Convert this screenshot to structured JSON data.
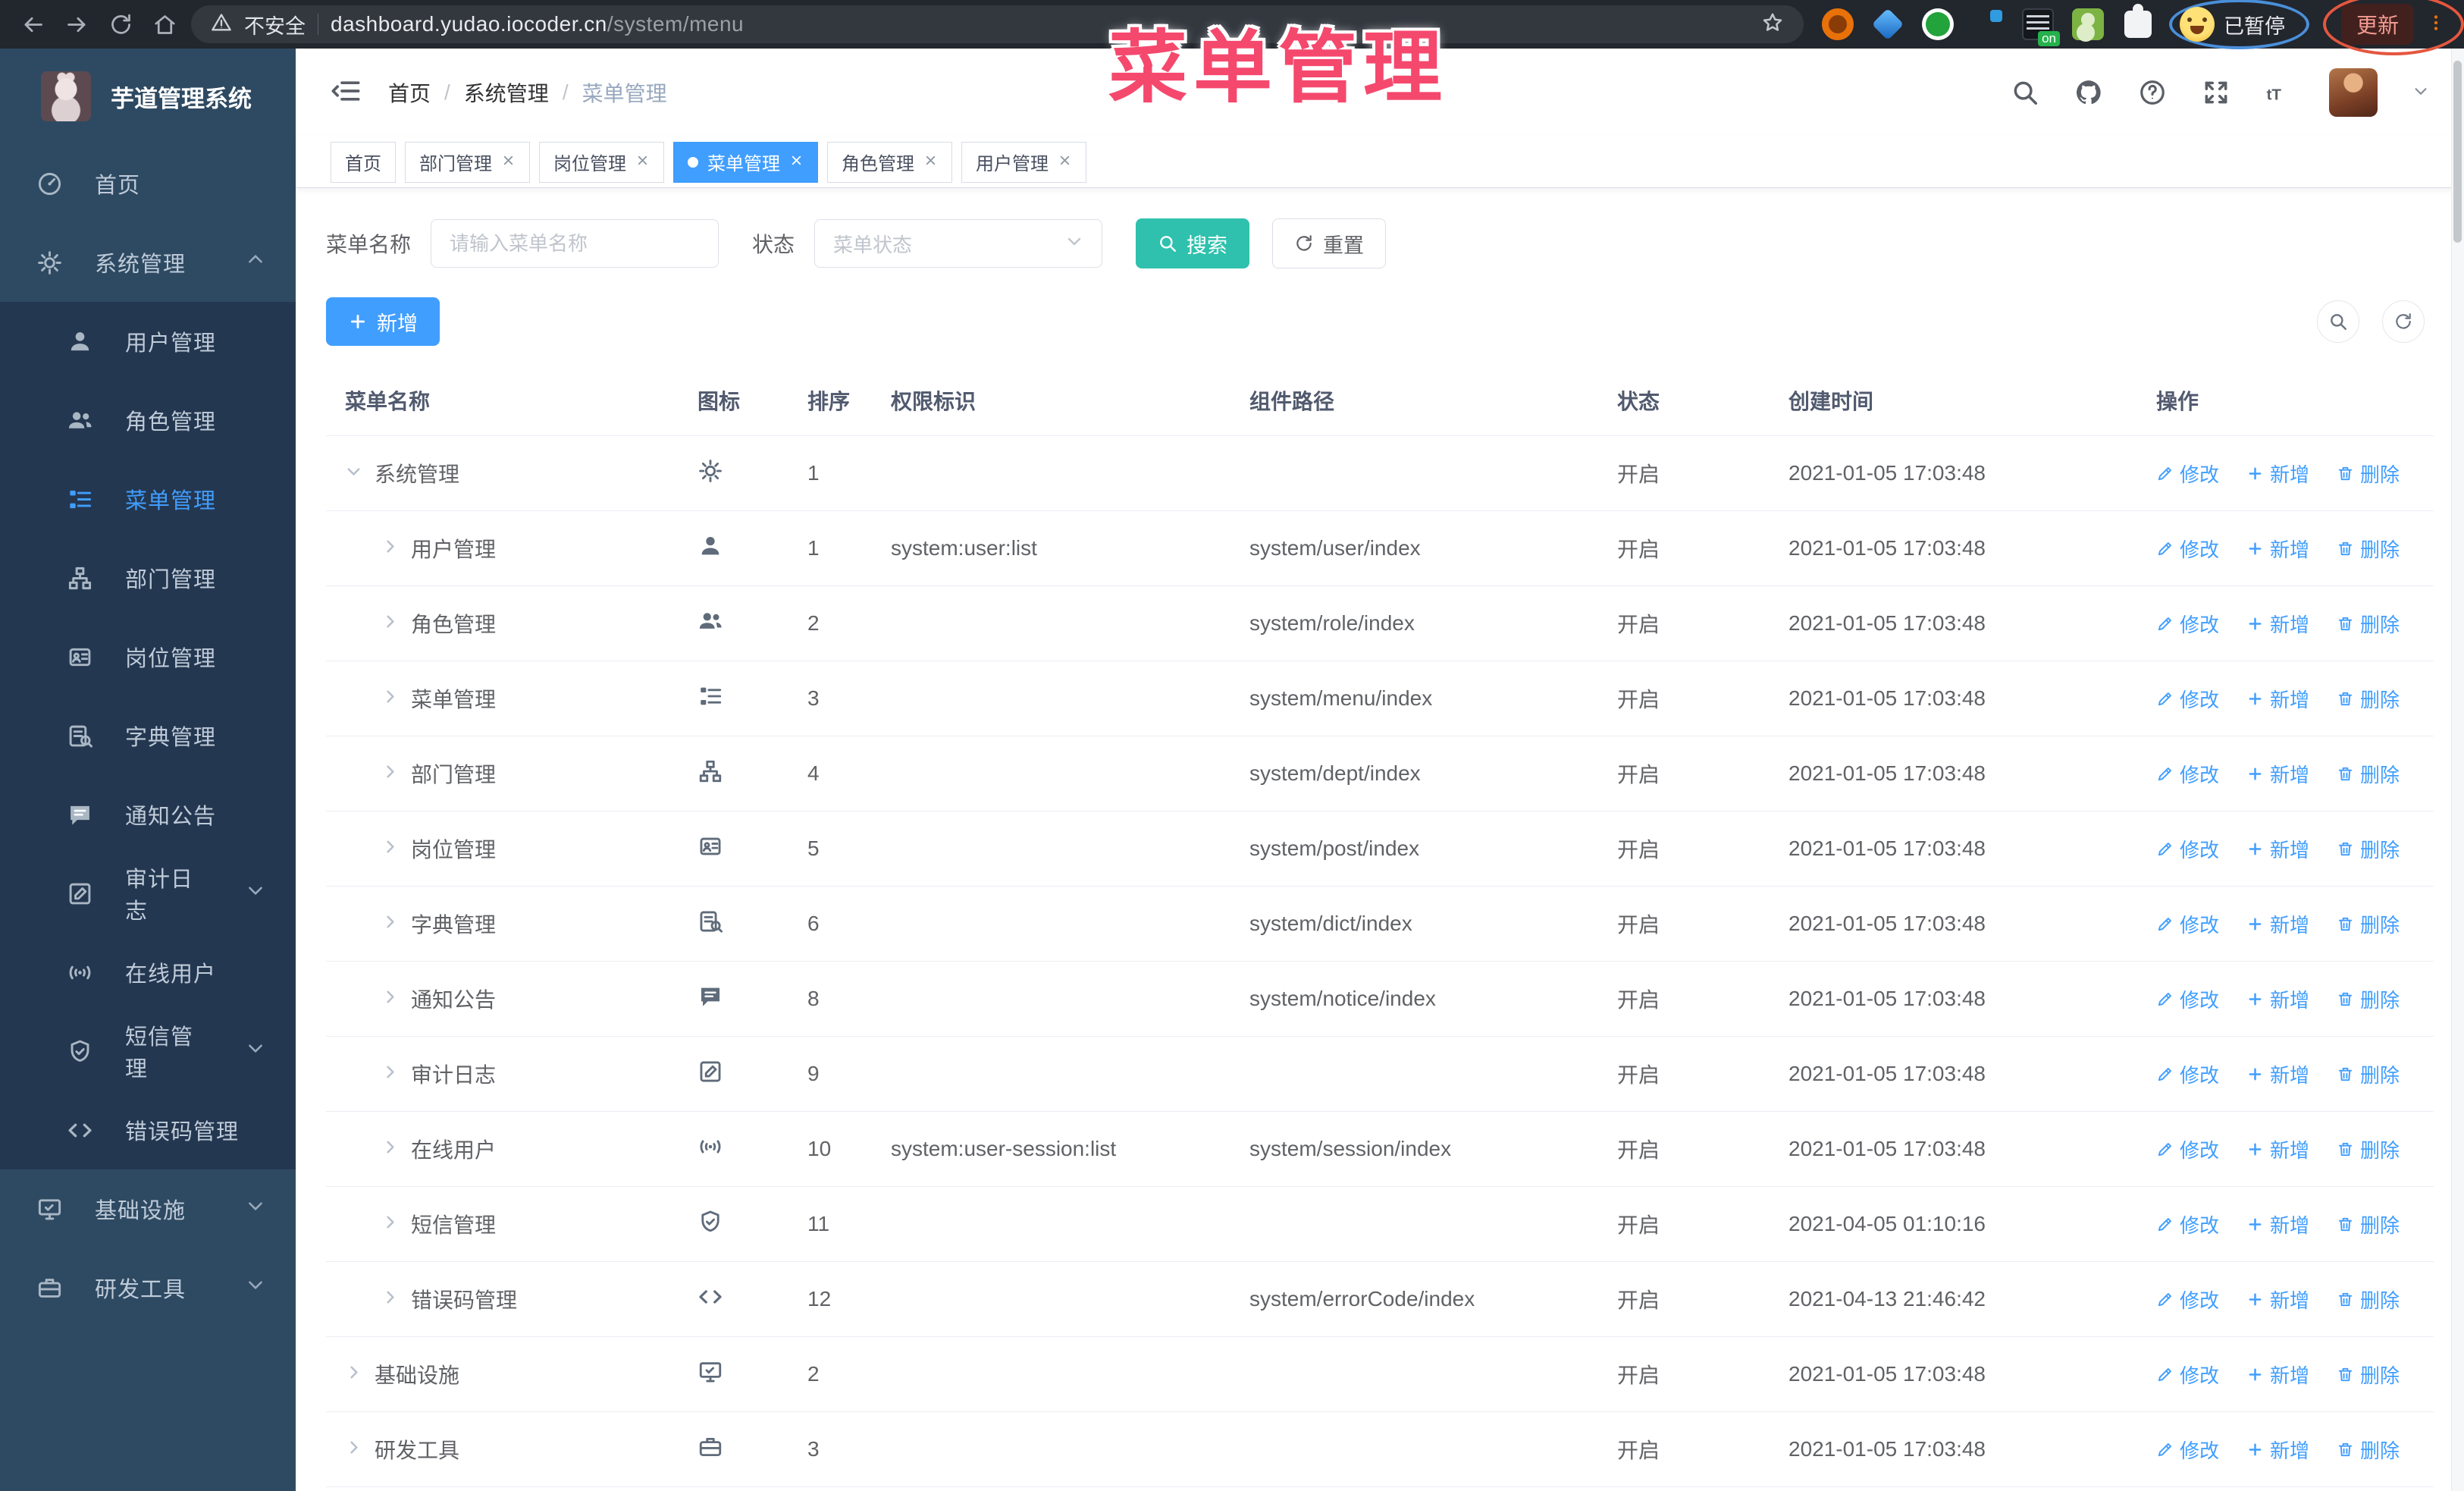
{
  "colors": {
    "accent": "#409EFF",
    "search_button": "#2FC1AD",
    "annotation": "#F5486D",
    "sidebar_bg": "#2E4A62",
    "submenu_bg": "#243750",
    "active_tab": "#409EFF"
  },
  "browser": {
    "nav_icons": [
      "back-icon",
      "forward-icon",
      "reload-icon",
      "home-icon"
    ],
    "security_label": "不安全",
    "url_host": "dashboard.yudao.iocoder.cn",
    "url_path": "/system/menu",
    "extension_icons": [
      "target-icon",
      "gem-icon",
      "shield-check-icon",
      "grid-icon",
      "switch-on-icon",
      "profile-icon",
      "puzzle-icon"
    ],
    "paused_label": "已暂停",
    "update_label": "更新"
  },
  "annotation": {
    "title": "菜单管理"
  },
  "sidebar": {
    "logo_title": "芋道管理系统",
    "menu": [
      {
        "label": "首页",
        "icon": "dashboard",
        "level": 0
      },
      {
        "label": "系统管理",
        "icon": "gear",
        "level": 0,
        "caret": "up"
      },
      {
        "label": "用户管理",
        "icon": "user",
        "level": 1
      },
      {
        "label": "角色管理",
        "icon": "users",
        "level": 1
      },
      {
        "label": "菜单管理",
        "icon": "tree-table",
        "level": 1,
        "active": true
      },
      {
        "label": "部门管理",
        "icon": "tree",
        "level": 1
      },
      {
        "label": "岗位管理",
        "icon": "post",
        "level": 1
      },
      {
        "label": "字典管理",
        "icon": "dict",
        "level": 1
      },
      {
        "label": "通知公告",
        "icon": "message",
        "level": 1
      },
      {
        "label": "审计日志",
        "icon": "log",
        "level": 1,
        "caret": "down"
      },
      {
        "label": "在线用户",
        "icon": "online",
        "level": 1
      },
      {
        "label": "短信管理",
        "icon": "sms",
        "level": 1,
        "caret": "down"
      },
      {
        "label": "错误码管理",
        "icon": "code",
        "level": 1
      },
      {
        "label": "基础设施",
        "icon": "monitor",
        "level": 0,
        "caret": "down"
      },
      {
        "label": "研发工具",
        "icon": "tool",
        "level": 0,
        "caret": "down"
      }
    ]
  },
  "header": {
    "breadcrumb": [
      "首页",
      "系统管理",
      "菜单管理"
    ],
    "icons": [
      "search",
      "github",
      "question",
      "fullscreen",
      "fontsize"
    ]
  },
  "tabs": [
    {
      "label": "首页",
      "closable": false,
      "active": false
    },
    {
      "label": "部门管理",
      "closable": true,
      "active": false
    },
    {
      "label": "岗位管理",
      "closable": true,
      "active": false
    },
    {
      "label": "菜单管理",
      "closable": true,
      "active": true
    },
    {
      "label": "角色管理",
      "closable": true,
      "active": false
    },
    {
      "label": "用户管理",
      "closable": true,
      "active": false
    }
  ],
  "filters": {
    "name_label": "菜单名称",
    "name_placeholder": "请输入菜单名称",
    "status_label": "状态",
    "status_placeholder": "菜单状态",
    "search_label": "搜索",
    "reset_label": "重置"
  },
  "toolbar": {
    "add_label": "新增",
    "circle_icons": [
      "search",
      "refresh"
    ]
  },
  "table": {
    "columns": [
      "菜单名称",
      "图标",
      "排序",
      "权限标识",
      "组件路径",
      "状态",
      "创建时间",
      "操作"
    ],
    "op_labels": [
      "修改",
      "新增",
      "删除"
    ],
    "rows": [
      {
        "name": "系统管理",
        "icon": "gear",
        "level": 0,
        "expanded": true,
        "sort": "1",
        "perm": "",
        "path": "",
        "status": "开启",
        "time": "2021-01-05 17:03:48"
      },
      {
        "name": "用户管理",
        "icon": "user",
        "level": 1,
        "expanded": false,
        "sort": "1",
        "perm": "system:user:list",
        "path": "system/user/index",
        "status": "开启",
        "time": "2021-01-05 17:03:48"
      },
      {
        "name": "角色管理",
        "icon": "users",
        "level": 1,
        "expanded": false,
        "sort": "2",
        "perm": "",
        "path": "system/role/index",
        "status": "开启",
        "time": "2021-01-05 17:03:48"
      },
      {
        "name": "菜单管理",
        "icon": "tree-table",
        "level": 1,
        "expanded": false,
        "sort": "3",
        "perm": "",
        "path": "system/menu/index",
        "status": "开启",
        "time": "2021-01-05 17:03:48"
      },
      {
        "name": "部门管理",
        "icon": "tree",
        "level": 1,
        "expanded": false,
        "sort": "4",
        "perm": "",
        "path": "system/dept/index",
        "status": "开启",
        "time": "2021-01-05 17:03:48"
      },
      {
        "name": "岗位管理",
        "icon": "post",
        "level": 1,
        "expanded": false,
        "sort": "5",
        "perm": "",
        "path": "system/post/index",
        "status": "开启",
        "time": "2021-01-05 17:03:48"
      },
      {
        "name": "字典管理",
        "icon": "dict",
        "level": 1,
        "expanded": false,
        "sort": "6",
        "perm": "",
        "path": "system/dict/index",
        "status": "开启",
        "time": "2021-01-05 17:03:48"
      },
      {
        "name": "通知公告",
        "icon": "message",
        "level": 1,
        "expanded": false,
        "sort": "8",
        "perm": "",
        "path": "system/notice/index",
        "status": "开启",
        "time": "2021-01-05 17:03:48"
      },
      {
        "name": "审计日志",
        "icon": "log",
        "level": 1,
        "expanded": false,
        "sort": "9",
        "perm": "",
        "path": "",
        "status": "开启",
        "time": "2021-01-05 17:03:48"
      },
      {
        "name": "在线用户",
        "icon": "online",
        "level": 1,
        "expanded": false,
        "sort": "10",
        "perm": "system:user-session:list",
        "path": "system/session/index",
        "status": "开启",
        "time": "2021-01-05 17:03:48"
      },
      {
        "name": "短信管理",
        "icon": "sms",
        "level": 1,
        "expanded": false,
        "sort": "11",
        "perm": "",
        "path": "",
        "status": "开启",
        "time": "2021-04-05 01:10:16"
      },
      {
        "name": "错误码管理",
        "icon": "code",
        "level": 1,
        "expanded": false,
        "sort": "12",
        "perm": "",
        "path": "system/errorCode/index",
        "status": "开启",
        "time": "2021-04-13 21:46:42"
      },
      {
        "name": "基础设施",
        "icon": "monitor",
        "level": 0,
        "expanded": false,
        "sort": "2",
        "perm": "",
        "path": "",
        "status": "开启",
        "time": "2021-01-05 17:03:48"
      },
      {
        "name": "研发工具",
        "icon": "tool",
        "level": 0,
        "expanded": false,
        "sort": "3",
        "perm": "",
        "path": "",
        "status": "开启",
        "time": "2021-01-05 17:03:48"
      }
    ]
  }
}
